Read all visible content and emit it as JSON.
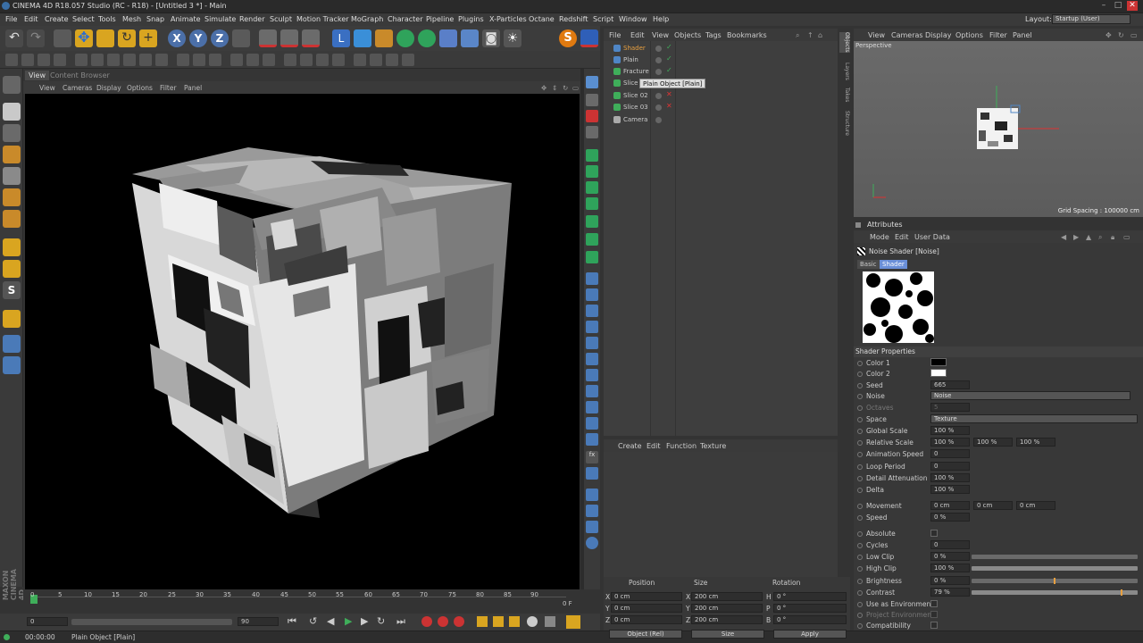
{
  "app": {
    "title": "CINEMA 4D R18.057 Studio (RC - R18) - [Untitled 3 *] - Main",
    "layout_label": "Layout:",
    "layout_value": "Startup (User)"
  },
  "menubar": [
    "File",
    "Edit",
    "Create",
    "Select",
    "Tools",
    "Mesh",
    "Snap",
    "Animate",
    "Simulate",
    "Render",
    "Sculpt",
    "Motion Tracker",
    "MoGraph",
    "Character",
    "Pipeline",
    "Plugins",
    "X-Particles",
    "Octane",
    "Redshift",
    "Script",
    "Window",
    "Help"
  ],
  "viewport": {
    "tabs": [
      "View",
      "Content Browser"
    ],
    "menu": [
      "View",
      "Cameras",
      "Display",
      "Options",
      "Filter",
      "Panel"
    ]
  },
  "timeline": {
    "ticks": [
      "0",
      "5",
      "10",
      "15",
      "20",
      "25",
      "30",
      "35",
      "40",
      "45",
      "50",
      "55",
      "60",
      "65",
      "70",
      "75",
      "80",
      "85",
      "90"
    ],
    "current_frame": "0 F",
    "start": "0",
    "end": "90"
  },
  "status": {
    "time": "00:00:00",
    "message": "Plain Object [Plain]"
  },
  "object_manager": {
    "menu": [
      "File",
      "Edit",
      "View",
      "Objects",
      "Tags",
      "Bookmarks"
    ],
    "objects": [
      {
        "name": "Shader",
        "icon": "shader-icon",
        "color": "#4f86c6",
        "visible": "green"
      },
      {
        "name": "Plain",
        "icon": "plain-icon",
        "color": "#4f86c6",
        "visible": "green"
      },
      {
        "name": "Fracture",
        "icon": "fracture-icon",
        "color": "#3fae5a",
        "visible": "green"
      },
      {
        "name": "Slice",
        "icon": "slice-icon",
        "color": "#3fae5a",
        "visible": "red"
      },
      {
        "name": "Slice 02",
        "icon": "slice-icon",
        "color": "#3fae5a",
        "visible": "red"
      },
      {
        "name": "Slice 03",
        "icon": "slice-icon",
        "color": "#3fae5a",
        "visible": "red"
      },
      {
        "name": "Camera",
        "icon": "camera-icon",
        "color": "#aaaaaa",
        "visible": "none"
      }
    ],
    "tooltip": "Plain Object [Plain]"
  },
  "side_tabs": [
    "Objects",
    "Layers",
    "Takes",
    "Structure"
  ],
  "material_manager": {
    "menu": [
      "Create",
      "Edit",
      "Function",
      "Texture"
    ]
  },
  "coordinates": {
    "headers": [
      "Position",
      "Size",
      "Rotation"
    ],
    "rows": [
      {
        "axis": "X",
        "pos": "0 cm",
        "size_axis": "X",
        "size": "200 cm",
        "rot_axis": "H",
        "rot": "0 °"
      },
      {
        "axis": "Y",
        "pos": "0 cm",
        "size_axis": "Y",
        "size": "200 cm",
        "rot_axis": "P",
        "rot": "0 °"
      },
      {
        "axis": "Z",
        "pos": "0 cm",
        "size_axis": "Z",
        "size": "200 cm",
        "rot_axis": "B",
        "rot": "0 °"
      }
    ],
    "mode": "Object (Rel)",
    "size_mode": "Size",
    "apply": "Apply"
  },
  "viewport2": {
    "menu": [
      "View",
      "Cameras",
      "Display",
      "Options",
      "Filter",
      "Panel"
    ],
    "label": "Perspective",
    "grid_spacing": "Grid Spacing : 100000 cm"
  },
  "attributes": {
    "header": "Attributes",
    "menu": [
      "Mode",
      "Edit",
      "User Data"
    ],
    "object_title": "Noise Shader [Noise]",
    "tabs": [
      "Basic",
      "Shader"
    ],
    "section": "Shader Properties",
    "color1_label": "Color 1",
    "color2_label": "Color 2",
    "color1": "#000000",
    "color2": "#ffffff",
    "seed_label": "Seed",
    "seed": "665",
    "noise_label": "Noise",
    "noise": "Noise",
    "octaves_label": "Octaves",
    "octaves": "5",
    "space_label": "Space",
    "space": "Texture",
    "global_scale_label": "Global Scale",
    "global_scale": "100 %",
    "relative_scale_label": "Relative Scale",
    "relative_scale": [
      "100 %",
      "100 %",
      "100 %"
    ],
    "anim_speed_label": "Animation Speed",
    "anim_speed": "0",
    "loop_period_label": "Loop Period",
    "loop_period": "0",
    "detail_att_label": "Detail Attenuation",
    "detail_att": "100 %",
    "delta_label": "Delta",
    "delta": "100 %",
    "movement_label": "Movement",
    "movement": [
      "0 cm",
      "0 cm",
      "0 cm"
    ],
    "speed_label": "Speed",
    "speed": "0 %",
    "absolute_label": "Absolute",
    "cycles_label": "Cycles",
    "cycles": "0",
    "low_clip_label": "Low Clip",
    "low_clip": "0 %",
    "high_clip_label": "High Clip",
    "high_clip": "100 %",
    "brightness_label": "Brightness",
    "brightness": "0 %",
    "contrast_label": "Contrast",
    "contrast": "79 %",
    "use_env_label": "Use as Environment",
    "proj_env_label": "Project Environment",
    "compat_label": "Compatibility"
  }
}
